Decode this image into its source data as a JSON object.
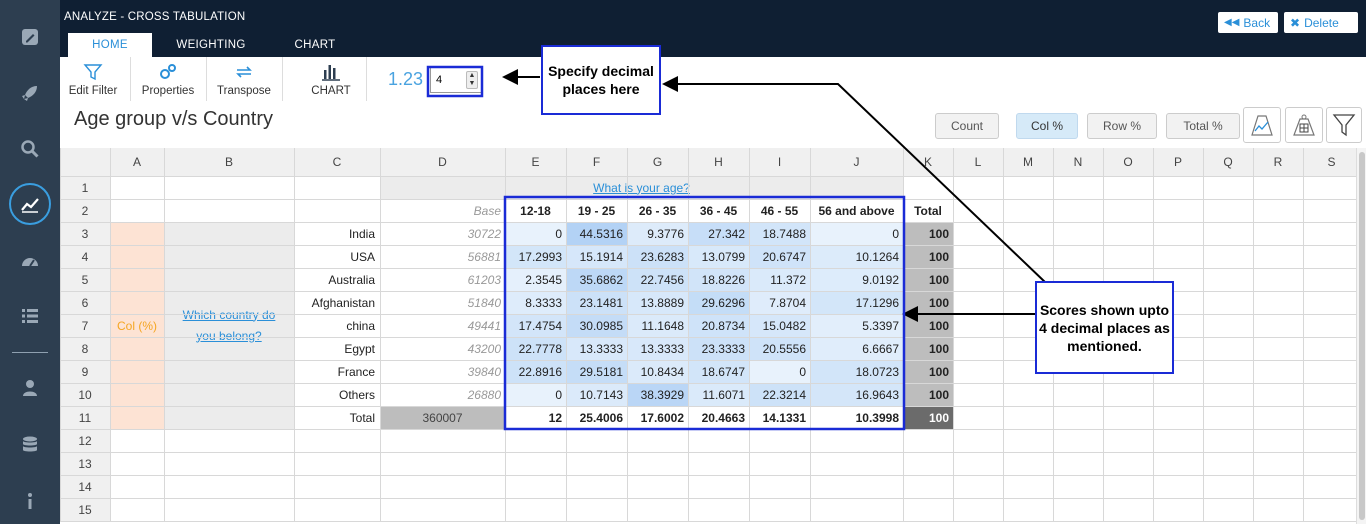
{
  "app": {
    "title": "ANALYZE - CROSS TABULATION",
    "tabs": [
      "HOME",
      "WEIGHTING",
      "CHART"
    ],
    "back_label": "Back",
    "delete_label": "Delete"
  },
  "sidebar": {
    "icons": [
      "edit-icon",
      "rocket-icon",
      "search-icon",
      "analytics-icon",
      "dashboard-icon",
      "list-icon",
      "user-icon",
      "database-icon",
      "info-icon"
    ]
  },
  "ribbon": {
    "edit_filter": "Edit Filter",
    "properties": "Properties",
    "transpose": "Transpose",
    "chart": "CHART",
    "decimal_label": "1.23",
    "decimal_value": "4"
  },
  "report": {
    "title": "Age group v/s Country",
    "modes": [
      "Count",
      "Col %",
      "Row %",
      "Total %"
    ],
    "active_mode": "Col %"
  },
  "sheet": {
    "columns": [
      "A",
      "B",
      "C",
      "D",
      "E",
      "F",
      "G",
      "H",
      "I",
      "J",
      "K",
      "L",
      "M",
      "N",
      "O",
      "P",
      "Q",
      "R",
      "S"
    ],
    "rows": [
      "1",
      "2",
      "3",
      "4",
      "5",
      "6",
      "7",
      "8",
      "9",
      "10",
      "11",
      "12",
      "13",
      "14",
      "15"
    ],
    "question_col": "What is your age?",
    "question_row": "Which country do you belong?",
    "stat_label": "Col (%)",
    "base_label": "Base",
    "age_groups": [
      "12-18",
      "19 - 25",
      "26 - 35",
      "36 - 45",
      "46 - 55",
      "56 and above"
    ],
    "total_label": "Total",
    "data_rows": [
      {
        "country": "India",
        "base": "30722",
        "values": [
          "0",
          "44.5316",
          "9.3776",
          "27.342",
          "18.7488",
          "0"
        ],
        "total": "100"
      },
      {
        "country": "USA",
        "base": "56881",
        "values": [
          "17.2993",
          "15.1914",
          "23.6283",
          "13.0799",
          "20.6747",
          "10.1264"
        ],
        "total": "100"
      },
      {
        "country": "Australia",
        "base": "61203",
        "values": [
          "2.3545",
          "35.6862",
          "22.7456",
          "18.8226",
          "11.372",
          "9.0192"
        ],
        "total": "100"
      },
      {
        "country": "Afghanistan",
        "base": "51840",
        "values": [
          "8.3333",
          "23.1481",
          "13.8889",
          "29.6296",
          "7.8704",
          "17.1296"
        ],
        "total": "100"
      },
      {
        "country": "china",
        "base": "49441",
        "values": [
          "17.4754",
          "30.0985",
          "11.1648",
          "20.8734",
          "15.0482",
          "5.3397"
        ],
        "total": "100"
      },
      {
        "country": "Egypt",
        "base": "43200",
        "values": [
          "22.7778",
          "13.3333",
          "13.3333",
          "23.3333",
          "20.5556",
          "6.6667"
        ],
        "total": "100"
      },
      {
        "country": "France",
        "base": "39840",
        "values": [
          "22.8916",
          "29.5181",
          "10.8434",
          "18.6747",
          "0",
          "18.0723"
        ],
        "total": "100"
      },
      {
        "country": "Others",
        "base": "26880",
        "values": [
          "0",
          "10.7143",
          "38.3929",
          "11.6071",
          "22.3214",
          "16.9643"
        ],
        "total": "100"
      }
    ],
    "total_row": {
      "label": "Total",
      "base": "360007",
      "values": [
        "12",
        "25.4006",
        "17.6002",
        "20.4663",
        "14.1331",
        "10.3998"
      ],
      "total": "100"
    }
  },
  "callouts": {
    "decimal": "Specify decimal places here",
    "scores": "Scores shown upto 4 decimal places as mentioned."
  },
  "colors": {
    "topbar": "#0f1f33",
    "sidebar": "#2d3e50",
    "accent": "#2a8fd8",
    "callout_border": "#1a2bd6",
    "stat_cell": "#fde3d4",
    "stat_text": "#f5a623"
  }
}
